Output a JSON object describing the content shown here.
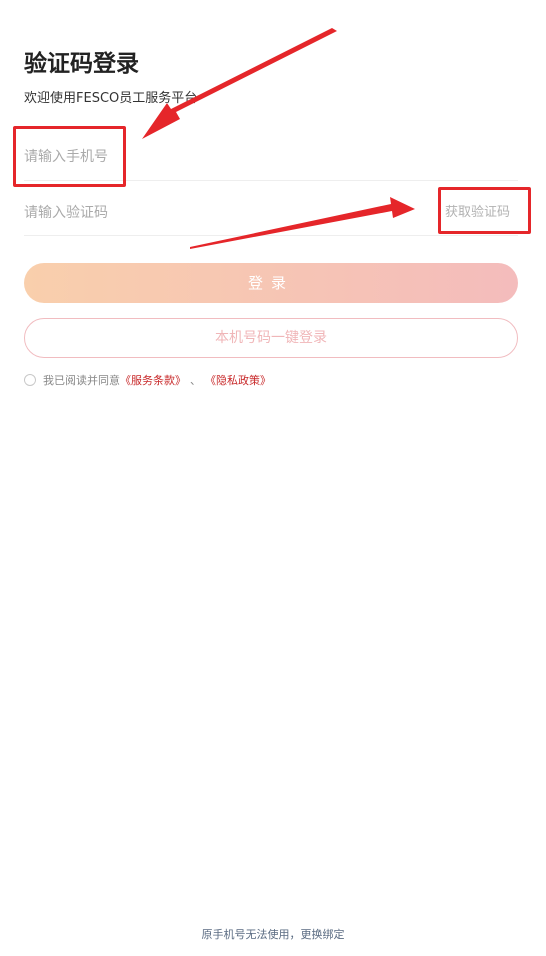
{
  "header": {
    "title": "验证码登录",
    "subtitle": "欢迎使用FESCO员工服务平台"
  },
  "form": {
    "phone_placeholder": "请输入手机号",
    "code_placeholder": "请输入验证码",
    "get_code_label": "获取验证码"
  },
  "buttons": {
    "login_label": "登录",
    "onekey_label": "本机号码一键登录"
  },
  "agreement": {
    "prefix": "我已阅读并同意",
    "terms_link": "《服务条款》",
    "separator": "、",
    "privacy_link": "《隐私政策》"
  },
  "footer": {
    "rebind_link": "原手机号无法使用，更换绑定"
  },
  "colors": {
    "annotation": "#e5262a",
    "link": "#c8292a",
    "primary_gradient_start": "#f9cfac",
    "primary_gradient_end": "#f4bcbc"
  }
}
